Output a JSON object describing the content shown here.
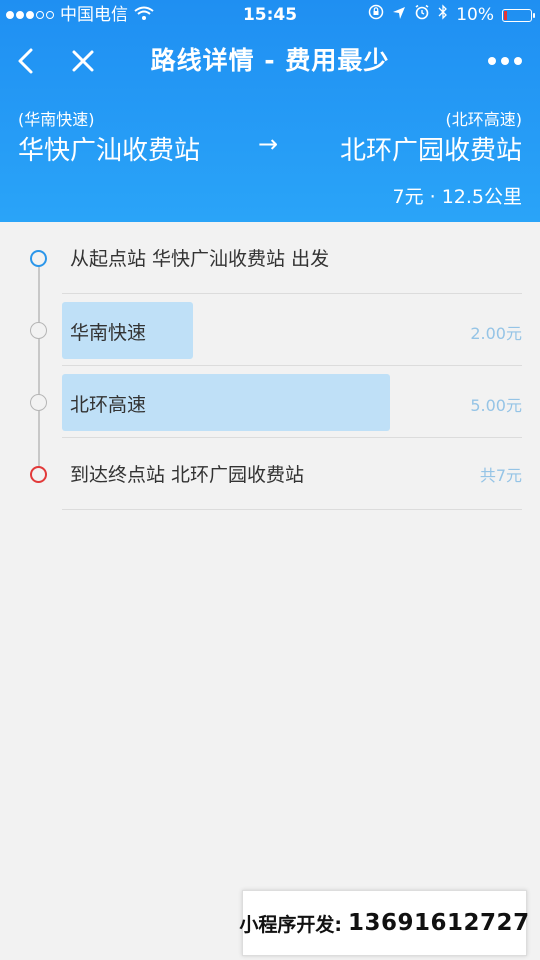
{
  "status_bar": {
    "carrier": "中国电信",
    "signal_bars_filled": 3,
    "signal_bars_total": 5,
    "time": "15:45",
    "battery_percent": "10%"
  },
  "nav": {
    "title": "路线详情 - 费用最少",
    "back_icon": "chevron-left-icon",
    "close_icon": "close-icon",
    "more_icon": "more-dots-icon"
  },
  "route": {
    "from_road": "(华南快速)",
    "from_station": "华快广汕收费站",
    "arrow": "→",
    "to_road": "(北环高速)",
    "to_station": "北环广园收费站",
    "summary": "7元 · 12.5公里"
  },
  "steps": [
    {
      "type": "start",
      "text": "从起点站 华快广汕收费站 出发"
    },
    {
      "type": "road",
      "text": "华南快速",
      "price": "2.00元",
      "bar_fraction": 0.4
    },
    {
      "type": "road",
      "text": "北环高速",
      "price": "5.00元",
      "bar_fraction": 1.0
    },
    {
      "type": "end",
      "text": "到达终点站 北环广园收费站",
      "price": "共7元"
    }
  ],
  "watermark": {
    "label": "小程序开发:",
    "number": "13691612727"
  },
  "colors": {
    "header_top": "#1f8ff2",
    "header_bottom": "#2aa4f8",
    "bar": "#bfe0f7",
    "price": "#95c4e6",
    "start_dot": "#2b96ea",
    "end_dot": "#e23a3a"
  }
}
